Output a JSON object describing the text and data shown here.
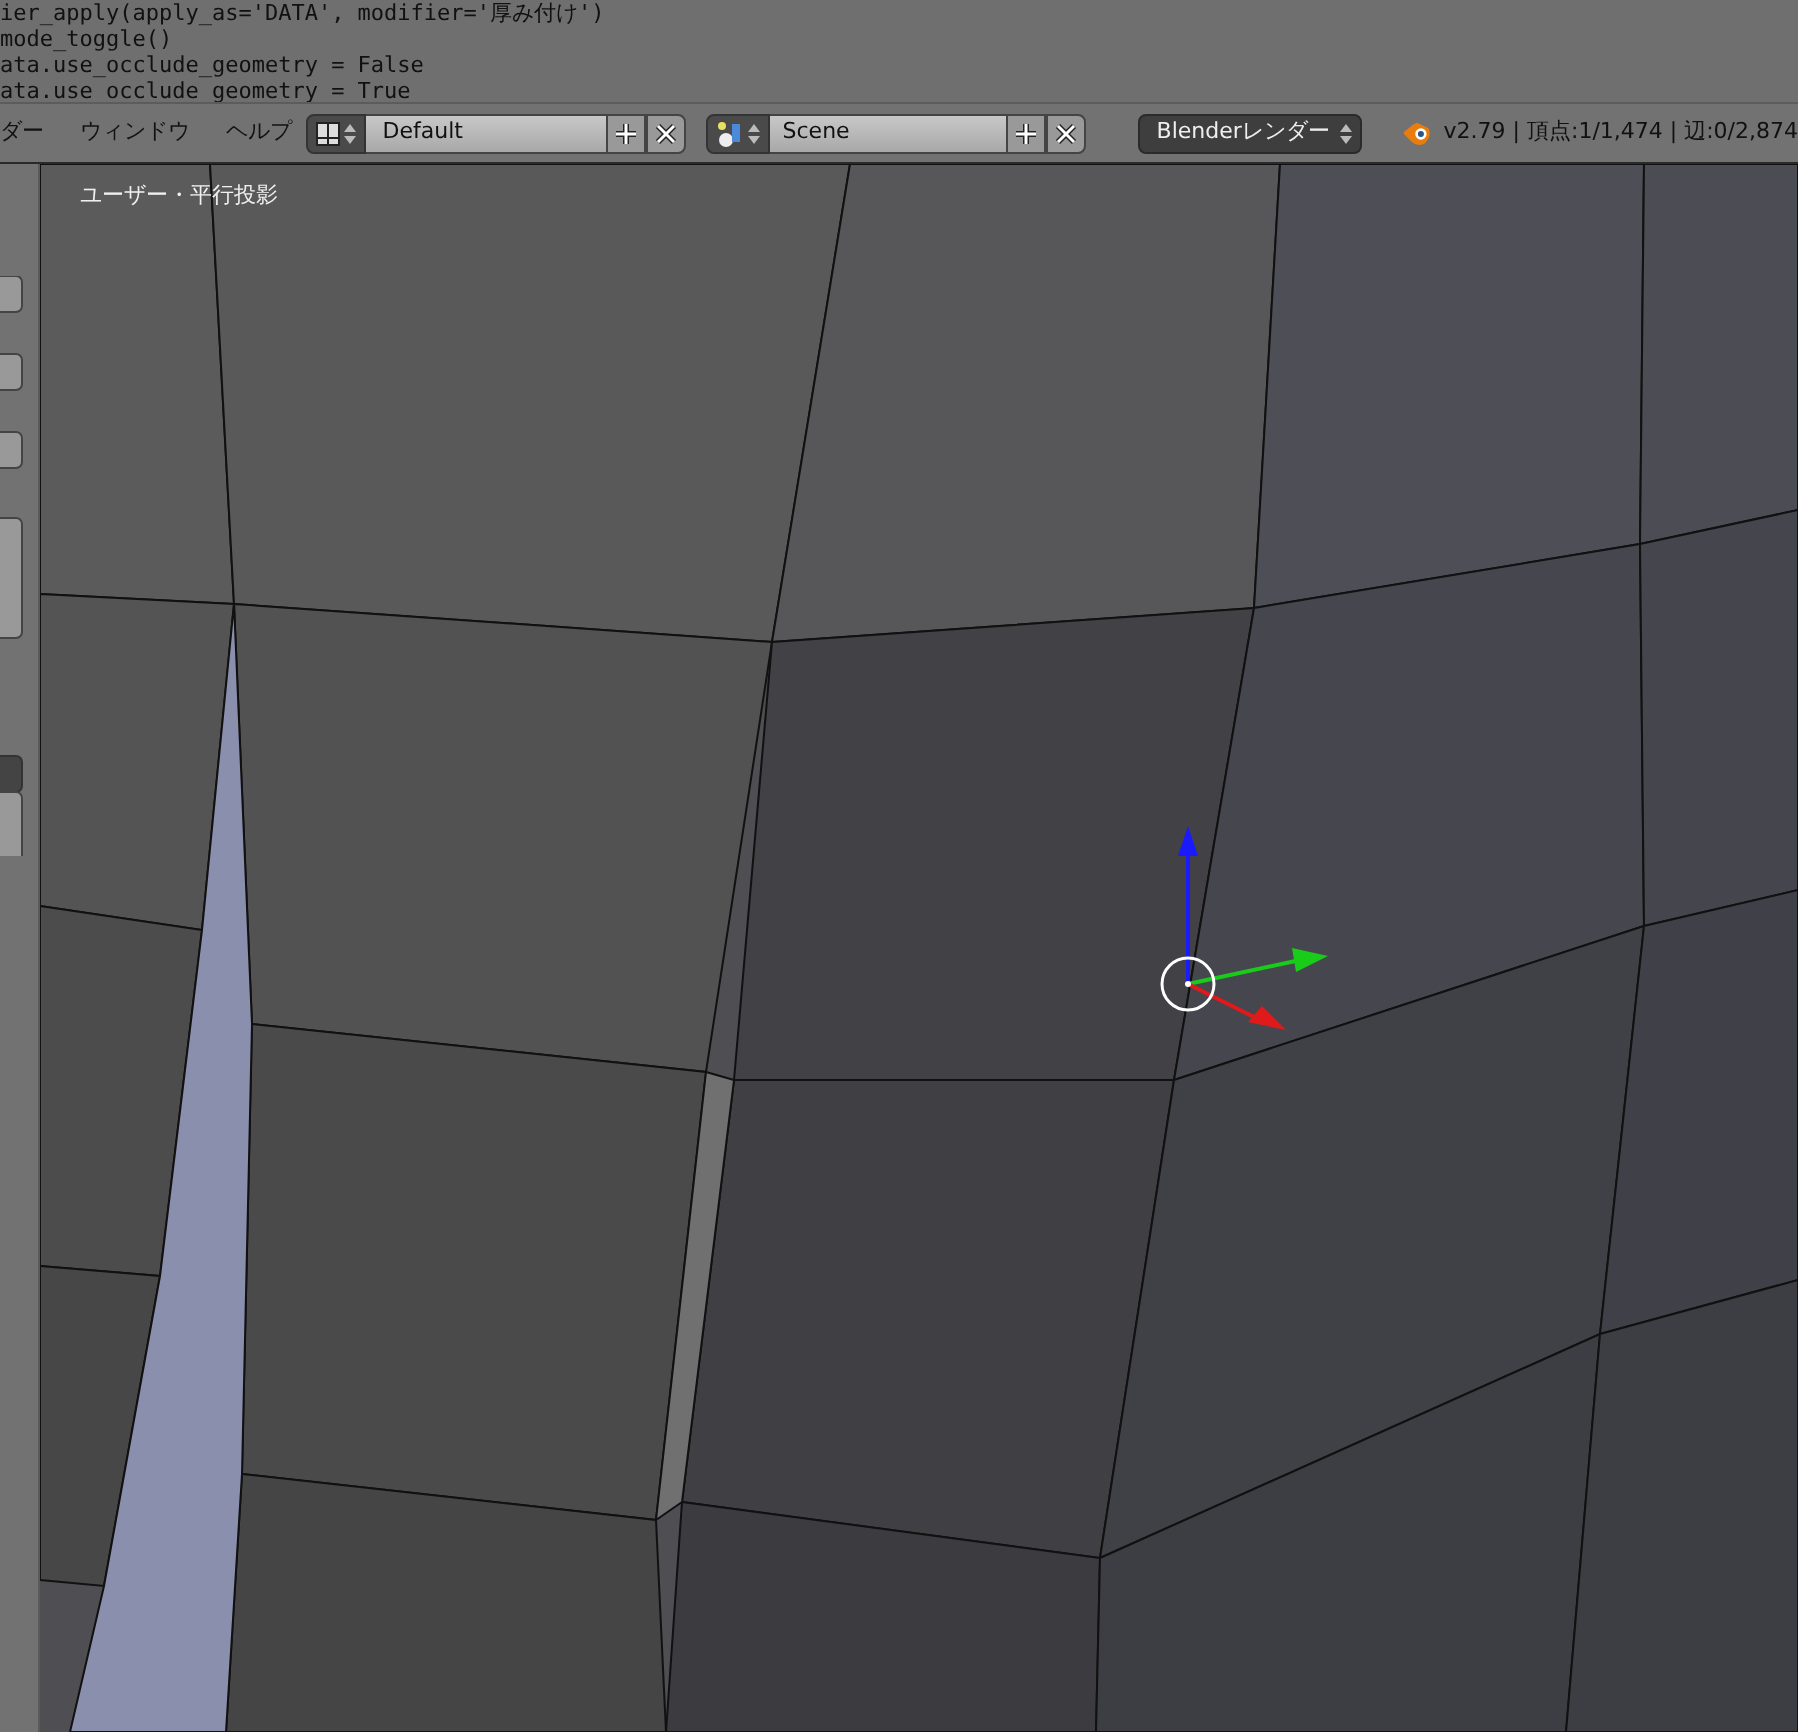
{
  "console": {
    "lines": [
      "ier_apply(apply_as='DATA', modifier='厚み付け')",
      "mode_toggle()",
      "ata.use_occlude_geometry = False",
      "ata.use_occlude_geometry = True"
    ]
  },
  "header": {
    "menus": [
      "ダー",
      "ウィンドウ",
      "ヘルプ"
    ],
    "screen_layout": {
      "value": "Default"
    },
    "scene": {
      "value": "Scene"
    },
    "render_engine": {
      "value": "Blenderレンダー"
    },
    "stats": "v2.79 | 頂点:1/1,474 | 辺:0/2,874"
  },
  "viewport": {
    "label": "ユーザー・平行投影"
  }
}
